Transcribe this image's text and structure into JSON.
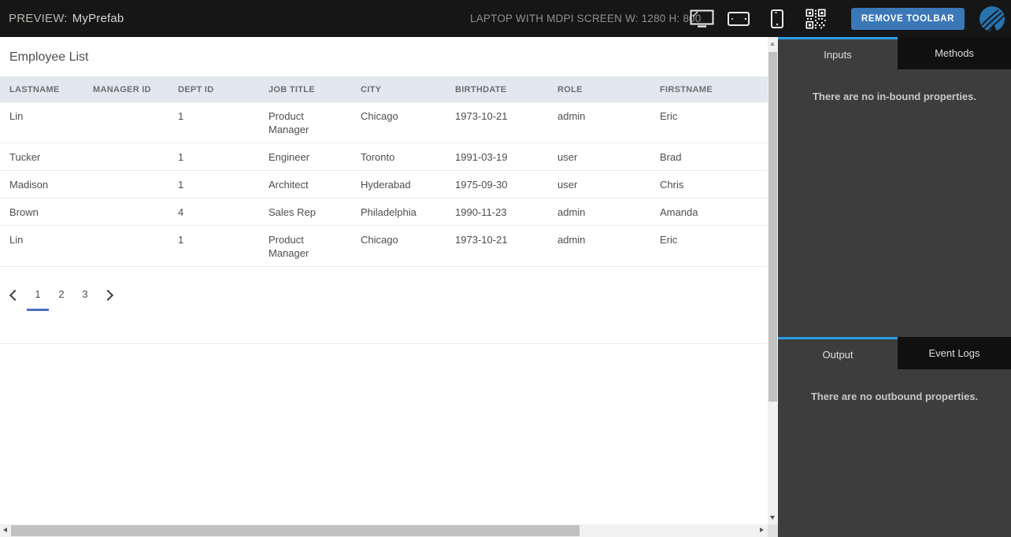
{
  "toolbar": {
    "preview_label": "PREVIEW:",
    "prefab_name": "MyPrefab",
    "device_label": "LAPTOP WITH MDPI SCREEN W: 1280 H: 800",
    "remove_toolbar_label": "REMOVE TOOLBAR",
    "icons": [
      "laptop-icon",
      "tablet-landscape-icon",
      "phone-portrait-icon",
      "qr-code-icon",
      "wavemaker-logo"
    ]
  },
  "preview": {
    "title": "Employee List",
    "table": {
      "columns": [
        "LASTNAME",
        "MANAGER ID",
        "DEPT ID",
        "JOB TITLE",
        "CITY",
        "BIRTHDATE",
        "ROLE",
        "FIRSTNAME"
      ],
      "rows": [
        [
          "Lin",
          "",
          "1",
          "Product Manager",
          "Chicago",
          "1973-10-21",
          "admin",
          "Eric"
        ],
        [
          "Tucker",
          "",
          "1",
          "Engineer",
          "Toronto",
          "1991-03-19",
          "user",
          "Brad"
        ],
        [
          "Madison",
          "",
          "1",
          "Architect",
          "Hyderabad",
          "1975-09-30",
          "user",
          "Chris"
        ],
        [
          "Brown",
          "",
          "4",
          "Sales Rep",
          "Philadelphia",
          "1990-11-23",
          "admin",
          "Amanda"
        ],
        [
          "Lin",
          "",
          "1",
          "Product Manager",
          "Chicago",
          "1973-10-21",
          "admin",
          "Eric"
        ]
      ]
    },
    "pagination": {
      "pages": [
        "1",
        "2",
        "3"
      ],
      "active_page": "1"
    }
  },
  "panel": {
    "inputs_tab": "Inputs",
    "methods_tab": "Methods",
    "inputs_message": "There are no in-bound properties.",
    "output_tab": "Output",
    "event_logs_tab": "Event Logs",
    "output_message": "There are no outbound properties."
  },
  "colors": {
    "toolbar_bg": "#161616",
    "panel_bg": "#3d3d3d",
    "inactive_tab_bg": "#101010",
    "tab_accent_blue": "#2b9ce5",
    "button_blue": "#3b78b8",
    "pagination_underline_blue": "#4a6fc4",
    "table_header_bg": "#e3e7f0",
    "logo_blue": "#2673ae"
  }
}
